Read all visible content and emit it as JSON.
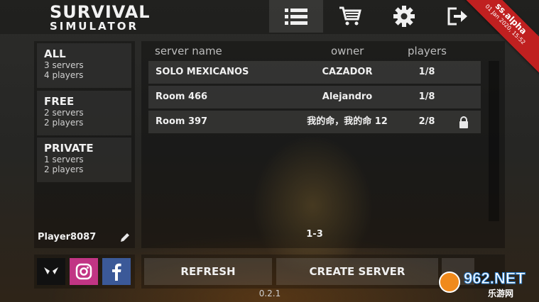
{
  "app": {
    "title_line1": "SURVIVAL",
    "title_line2": "SIMULATOR",
    "build_label": "ss.alpha",
    "build_date": "01 Jan 2020, 15:52",
    "version": "0.2.1"
  },
  "nav": [
    {
      "name": "server-list",
      "icon": "list-icon",
      "active": true
    },
    {
      "name": "shop",
      "icon": "cart-icon",
      "active": false
    },
    {
      "name": "settings",
      "icon": "gear-icon",
      "active": false
    },
    {
      "name": "exit",
      "icon": "exit-icon",
      "active": false
    }
  ],
  "filters": [
    {
      "label": "ALL",
      "servers": "3 servers",
      "players": "4 players"
    },
    {
      "label": "FREE",
      "servers": "2 servers",
      "players": "2 players"
    },
    {
      "label": "PRIVATE",
      "servers": "1 servers",
      "players": "2 players"
    }
  ],
  "player": {
    "name": "Player8087"
  },
  "table": {
    "headers": {
      "name": "server name",
      "owner": "owner",
      "players": "players"
    },
    "rows": [
      {
        "name": "SOLO MEXICANOS",
        "owner": "CAZADOR",
        "players": "1/8",
        "locked": false
      },
      {
        "name": "Room 466",
        "owner": "Alejandro",
        "players": "1/8",
        "locked": false
      },
      {
        "name": "Room 397",
        "owner": "我的命，我的命 12",
        "players": "2/8",
        "locked": true
      }
    ],
    "pagination": "1-3"
  },
  "actions": {
    "refresh": "REFRESH",
    "create": "CREATE SERVER"
  },
  "social": [
    "alien-icon",
    "instagram-icon",
    "facebook-icon"
  ],
  "watermark": {
    "brand": "962",
    "domain": ".NET",
    "cn": "乐游网"
  },
  "colors": {
    "ribbon": "#c02020",
    "instagram": "#c13584",
    "facebook": "#3b5998"
  }
}
